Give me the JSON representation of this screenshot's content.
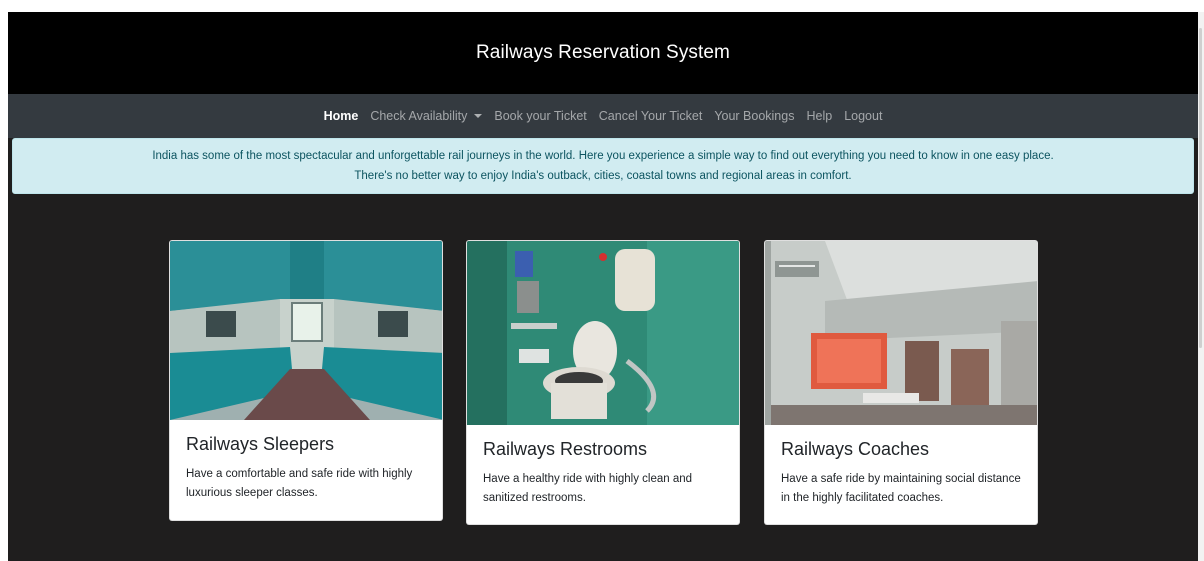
{
  "header": {
    "title": "Railways Reservation System"
  },
  "nav": {
    "items": [
      {
        "label": "Home",
        "active": true
      },
      {
        "label": "Check Availability",
        "dropdown": true
      },
      {
        "label": "Book your Ticket"
      },
      {
        "label": "Cancel Your Ticket"
      },
      {
        "label": "Your Bookings"
      },
      {
        "label": "Help"
      },
      {
        "label": "Logout"
      }
    ]
  },
  "alert": {
    "line1": "India has some of the most spectacular and unforgettable rail journeys in the world. Here you experience a simple way to find out everything you need to know in one easy place.",
    "line2": "There's no better way to enjoy India's outback, cities, coastal towns and regional areas in comfort."
  },
  "cards": [
    {
      "title": "Railways Sleepers",
      "text": "Have a comfortable and safe ride with highly luxurious sleeper classes.",
      "image": "sleeper-coach-photo"
    },
    {
      "title": "Railways Restrooms",
      "text": "Have a healthy ride with highly clean and sanitized restrooms.",
      "image": "restroom-photo"
    },
    {
      "title": "Railways Coaches",
      "text": "Have a safe ride by maintaining social distance in the highly facilitated coaches.",
      "image": "coach-interior-photo"
    }
  ],
  "colors": {
    "header_bg": "#000000",
    "navbar_bg": "#343a40",
    "alert_bg": "#d1ecf1",
    "alert_text": "#0c5460",
    "page_bg": "#1f1e1e"
  }
}
